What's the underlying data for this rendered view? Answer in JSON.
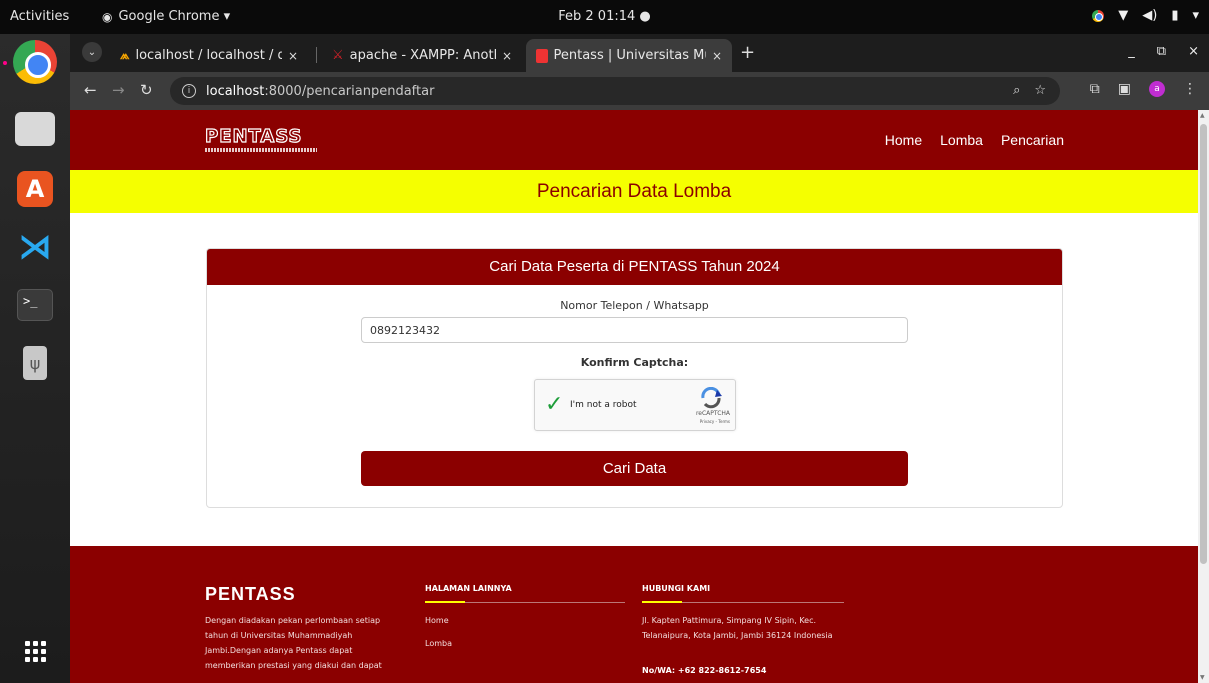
{
  "topbar": {
    "activities": "Activities",
    "app_name": "Google Chrome ▾",
    "clock": "Feb 2  01:14  ●",
    "tray_icons": [
      "chrome-icon",
      "wifi-icon",
      "volume-icon",
      "battery-icon",
      "chevron-down-icon"
    ]
  },
  "dock": {
    "items": [
      "chrome",
      "files",
      "app-store",
      "vscode",
      "terminal",
      "usb-drive",
      "show-apps"
    ]
  },
  "browser": {
    "tabs": [
      {
        "title": "localhost / localhost / db",
        "close": "×"
      },
      {
        "title": "apache - XAMPP: Anothe",
        "close": "×"
      },
      {
        "title": "Pentass | Universitas Mu",
        "close": "×"
      }
    ],
    "new_tab": "+",
    "window_controls": [
      "_",
      "⧉",
      "×"
    ],
    "url_host": "localhost",
    "url_path": ":8000/pencarianpendaftar",
    "accent": "#8b0000",
    "banner_color": "#f5ff00"
  },
  "site": {
    "logo_text": "PENTASS",
    "nav": [
      "Home",
      "Lomba",
      "Pencarian"
    ],
    "hero_title": "Pencarian Data Lomba",
    "card": {
      "title": "Cari Data Peserta di PENTASS Tahun 2024",
      "phone_label": "Nomor Telepon / Whatsapp",
      "phone_value": "0892123432",
      "captcha_label": "Konfirm Captcha:",
      "captcha_text": "I'm not a robot",
      "captcha_brand": "reCAPTCHA",
      "captcha_links": "Privacy - Terms",
      "captcha_checked": true,
      "submit_label": "Cari Data"
    },
    "footer": {
      "title": "PENTASS",
      "description": "Dengan diadakan pekan perlombaan setiap tahun di Universitas Muhammadiyah Jambi.Dengan adanya Pentass dapat memberikan prestasi yang diakui dan dapat",
      "pages_heading": "HALAMAN LAINNYA",
      "pages": [
        "Home",
        "Lomba"
      ],
      "contact_heading": "HUBUNGI KAMI",
      "address": "Jl. Kapten Pattimura, Simpang IV Sipin, Kec. Telanaipura, Kota Jambi, Jambi 36124 Indonesia",
      "whatsapp": "No/WA: +62 822-8612-7654"
    }
  }
}
